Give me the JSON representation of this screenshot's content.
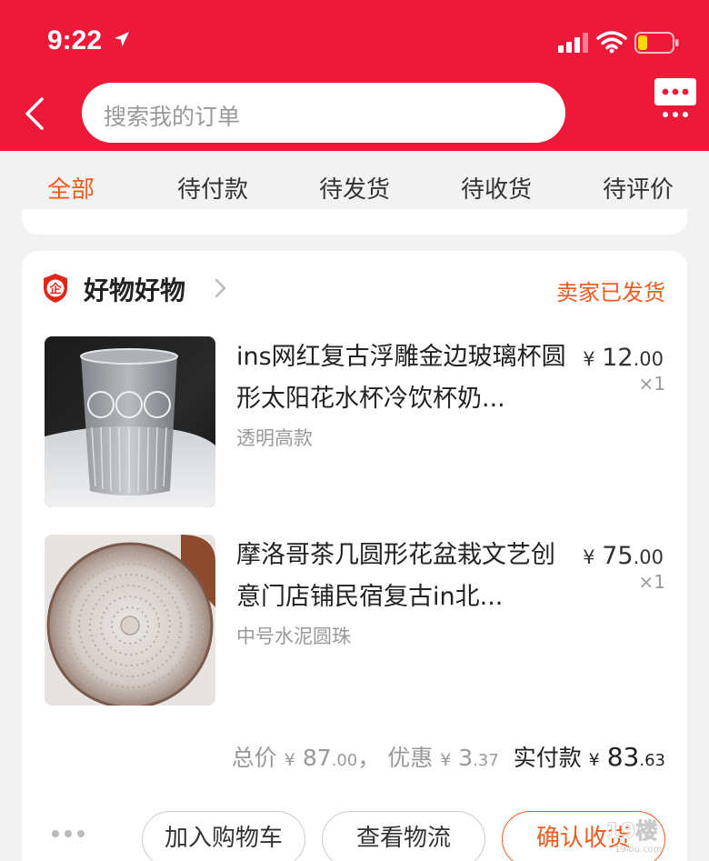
{
  "status_bar": {
    "time": "9:22"
  },
  "search": {
    "placeholder": "搜索我的订单"
  },
  "tabs": [
    {
      "label": "全部",
      "active": true
    },
    {
      "label": "待付款",
      "active": false
    },
    {
      "label": "待发货",
      "active": false
    },
    {
      "label": "待收货",
      "active": false
    },
    {
      "label": "待评价",
      "active": false
    }
  ],
  "order": {
    "shop_badge": "企",
    "shop_name": "好物好物",
    "status": "卖家已发货",
    "items": [
      {
        "title": "ins网红复古浮雕金边玻璃杯圆形太阳花水杯冷饮杯奶...",
        "sku": "透明高款",
        "price_symbol": "¥",
        "price_int": "12",
        "price_dec": ".00",
        "qty": "×1"
      },
      {
        "title": "摩洛哥茶几圆形花盆栽文艺创意门店铺民宿复古in北...",
        "sku": "中号水泥圆珠",
        "price_symbol": "¥",
        "price_int": "75",
        "price_dec": ".00",
        "qty": "×1"
      }
    ],
    "summary": {
      "total_label": "总价",
      "currency": "¥",
      "total_int": "87",
      "total_dec": ".00",
      "separator": "，",
      "discount_label": "优惠",
      "discount_int": "3",
      "discount_dec": ".37",
      "paid_label": "实付款",
      "paid_int": "83",
      "paid_dec": ".63"
    },
    "actions": {
      "add_to_cart": "加入购物车",
      "view_logistics": "查看物流",
      "confirm_receipt": "确认收货"
    }
  },
  "watermark": {
    "logo": "19楼",
    "domain": "19lou.com"
  },
  "colors": {
    "header": "#ec1a38",
    "accent": "#f05a1e",
    "background": "#f2f2f2",
    "card": "#ffffff"
  },
  "icons": [
    "location-arrow-icon",
    "signal-icon",
    "wifi-icon",
    "battery-low-icon",
    "back-chevron-icon",
    "message-bubble-icon",
    "shop-badge-icon",
    "chevron-right-icon",
    "more-dots-icon"
  ]
}
